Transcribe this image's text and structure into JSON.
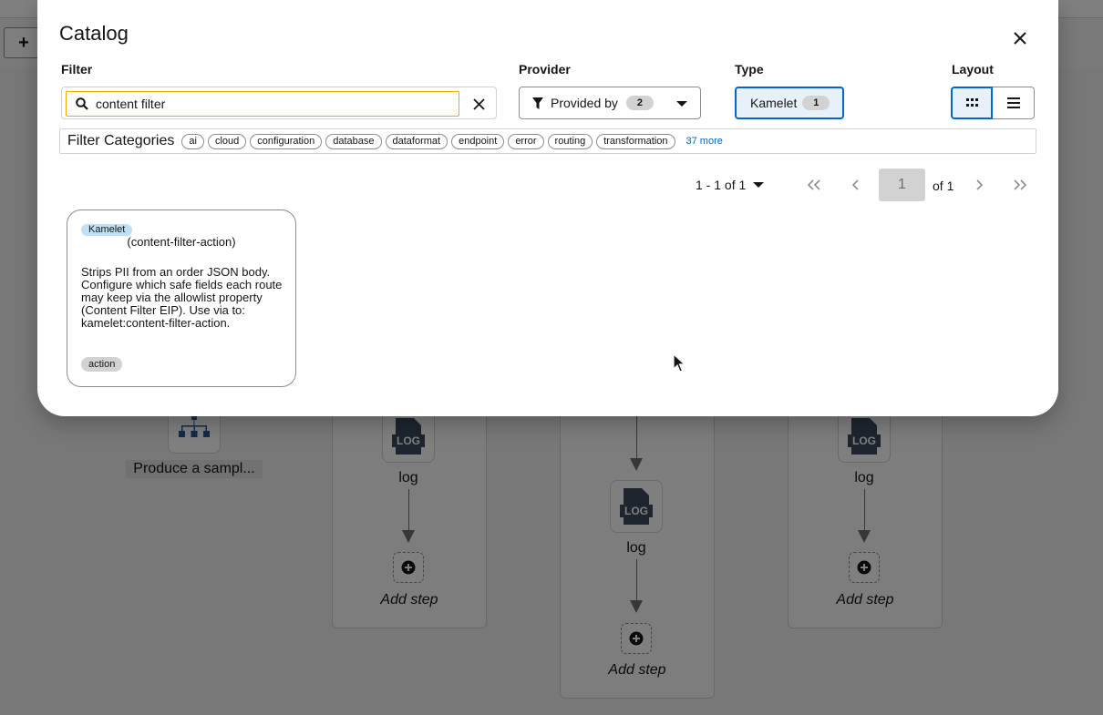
{
  "app": {
    "toolbar": {
      "add_label": "+"
    }
  },
  "canvas": {
    "produce_label": "Produce a sampl...",
    "routes": [
      {
        "step_label": "log",
        "add_step_label": "Add step"
      },
      {
        "step_label": "log",
        "add_step_label": "Add step"
      },
      {
        "step_label": "log",
        "add_step_label": "Add step"
      }
    ],
    "log_icon_text": "LOG"
  },
  "modal": {
    "title": "Catalog",
    "filter_label": "Filter",
    "search": {
      "value": "content filter",
      "placeholder": ""
    },
    "provider": {
      "label": "Provider",
      "button_label": "Provided by",
      "count": "2"
    },
    "type": {
      "label": "Type",
      "value": "Kamelet",
      "count": "1"
    },
    "layout": {
      "label": "Layout",
      "selected": "gallery"
    },
    "categories": {
      "title": "Filter Categories",
      "chips": [
        "ai",
        "cloud",
        "configuration",
        "database",
        "dataformat",
        "endpoint",
        "error",
        "routing",
        "transformation"
      ],
      "more": "37 more"
    },
    "pagination": {
      "range": "1 - 1 of 1",
      "page": "1",
      "of_pages": "of 1"
    },
    "tiles": [
      {
        "type": "Kamelet",
        "name": "(content-filter-action)",
        "description": "Strips PII from an order JSON body. Configure which safe fields each route may keep via the allowlist property (Content Filter EIP). Use via to: kamelet:content-filter-action.",
        "tag": "action"
      }
    ]
  },
  "colors": {
    "accent": "#0066cc",
    "search_focus": "#f0ab00",
    "badge_bg": "#d2d2d2",
    "kamelet_label": "#bee1f4"
  },
  "icons": [
    "plus-icon",
    "search-icon",
    "clear-icon",
    "close-icon",
    "filter-icon",
    "caret-down-icon",
    "grid-icon",
    "list-icon",
    "first-page-icon",
    "prev-page-icon",
    "next-page-icon",
    "last-page-icon",
    "log-icon",
    "add-step-icon",
    "hierarchy-icon",
    "mouse-pointer-icon"
  ]
}
